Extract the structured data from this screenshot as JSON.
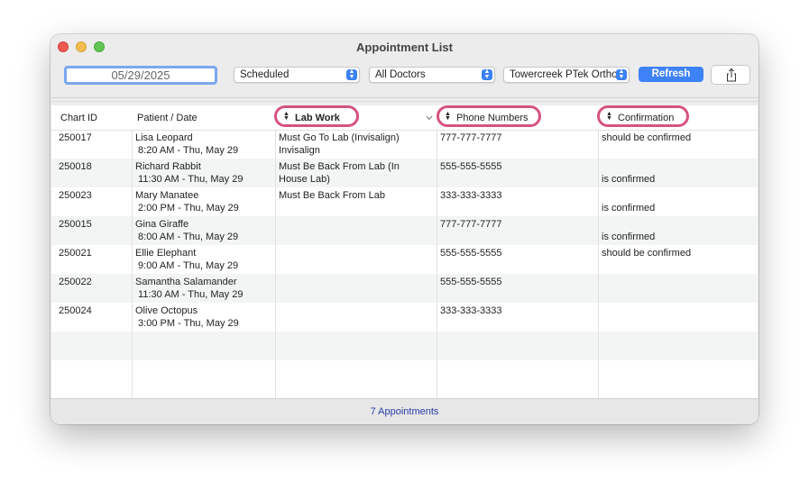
{
  "window": {
    "title": "Appointment List"
  },
  "toolbar": {
    "date": "05/29/2025",
    "status_select": "Scheduled",
    "doctor_select": "All Doctors",
    "location_select": "Towercreek PTek Ortho",
    "refresh_label": "Refresh",
    "share_icon": "share-icon"
  },
  "table": {
    "headers": {
      "chart_id": "Chart ID",
      "patient_date": "Patient / Date",
      "lab_work": "Lab Work",
      "phone": "Phone Numbers",
      "confirmation": "Confirmation"
    },
    "rows": [
      {
        "chart_id": "250017",
        "patient": "Lisa Leopard",
        "time": " 8:20 AM - Thu, May 29",
        "lab": "Must Go To Lab (Invisalign)\nInvisalign",
        "phone": "777-777-7777",
        "confirm": "should be confirmed",
        "confirm_pos": "top"
      },
      {
        "chart_id": "250018",
        "patient": "Richard Rabbit",
        "time": " 11:30 AM - Thu, May 29",
        "lab": "Must Be Back From Lab (In\nHouse Lab)",
        "phone": "555-555-5555",
        "confirm": "is confirmed",
        "confirm_pos": "bottom"
      },
      {
        "chart_id": "250023",
        "patient": "Mary Manatee",
        "time": " 2:00 PM - Thu, May 29",
        "lab": "Must Be Back From Lab",
        "phone": "333-333-3333",
        "confirm": "is confirmed",
        "confirm_pos": "bottom"
      },
      {
        "chart_id": "250015",
        "patient": "Gina Giraffe",
        "time": " 8:00 AM - Thu, May 29",
        "lab": "",
        "phone": "777-777-7777",
        "confirm": "is confirmed",
        "confirm_pos": "bottom"
      },
      {
        "chart_id": "250021",
        "patient": "Ellie Elephant",
        "time": " 9:00 AM - Thu, May 29",
        "lab": "",
        "phone": "555-555-5555",
        "confirm": "should be confirmed",
        "confirm_pos": "top"
      },
      {
        "chart_id": "250022",
        "patient": "Samantha Salamander",
        "time": " 11:30 AM - Thu, May 29",
        "lab": "",
        "phone": "555-555-5555",
        "confirm": "",
        "confirm_pos": "top"
      },
      {
        "chart_id": "250024",
        "patient": "Olive Octopus",
        "time": " 3:00 PM - Thu, May 29",
        "lab": "",
        "phone": "333-333-3333",
        "confirm": "",
        "confirm_pos": "top"
      }
    ]
  },
  "footer": {
    "count_label": "7 Appointments"
  }
}
